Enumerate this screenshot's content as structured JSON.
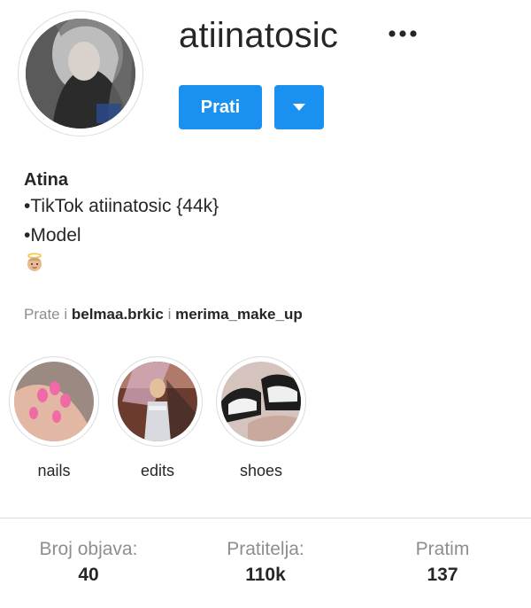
{
  "profile": {
    "username": "atiinatosic",
    "follow_label": "Prati",
    "more_icon": "more-horizontal-icon",
    "dropdown_icon": "caret-down-icon"
  },
  "bio": {
    "name": "Atina",
    "lines": [
      "•TikTok atiinatosic {44k}",
      "•Model"
    ],
    "emoji": "angel-emoji"
  },
  "followed_by": {
    "prefix": "Prate i",
    "user1": "belmaa.brkic",
    "joiner": "i",
    "user2": "merima_make_up"
  },
  "highlights": [
    {
      "label": "nails"
    },
    {
      "label": "edits"
    },
    {
      "label": "shoes"
    }
  ],
  "stats": [
    {
      "label": "Broj objava:",
      "value": "40"
    },
    {
      "label": "Pratitelja:",
      "value": "110k"
    },
    {
      "label": "Pratim",
      "value": "137"
    }
  ],
  "colors": {
    "accent": "#1a91f0",
    "text": "#262626",
    "muted": "#8e8e8e",
    "border": "#dbdbdb"
  }
}
